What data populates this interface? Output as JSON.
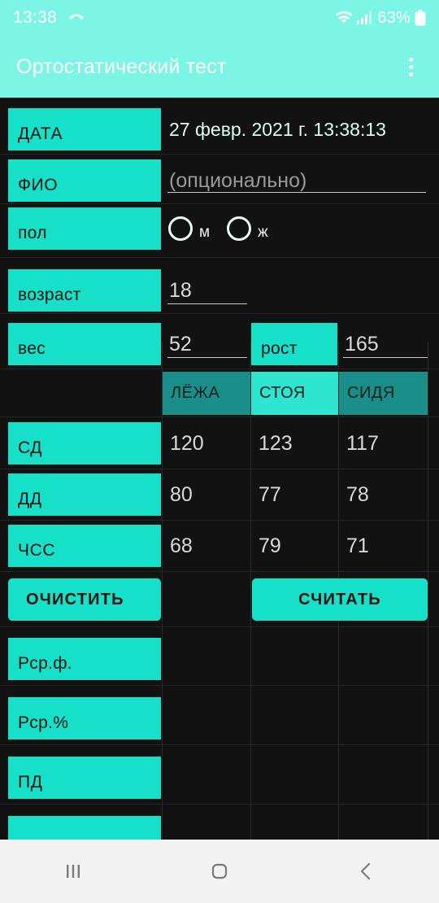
{
  "status_bar": {
    "time": "13:38",
    "call_icon": "missed-call-icon",
    "wifi_icon": "wifi-icon",
    "signal_icon": "signal-bars-icon",
    "battery_text": "63%",
    "battery_icon": "battery-icon"
  },
  "app_bar": {
    "title": "Ортостатический тест",
    "overflow_icon": "overflow-menu-icon"
  },
  "form": {
    "date": {
      "label": "ДАТА",
      "value": "27 февр. 2021 г. 13:38:13"
    },
    "name": {
      "label": "ФИО",
      "value": "",
      "placeholder": "(опционально)"
    },
    "sex": {
      "label": "пол",
      "options": [
        {
          "label": "м",
          "selected": false
        },
        {
          "label": "ж",
          "selected": false
        }
      ]
    },
    "age": {
      "label": "возраст",
      "value": "18"
    },
    "weight": {
      "label": "вес",
      "value": "52"
    },
    "height": {
      "label": "рост",
      "value": "165"
    }
  },
  "table": {
    "columns": [
      {
        "label": "ЛЁЖА",
        "active": false
      },
      {
        "label": "СТОЯ",
        "active": true
      },
      {
        "label": "СИДЯ",
        "active": false
      }
    ],
    "rows": [
      {
        "label": "СД",
        "values": [
          "120",
          "123",
          "117"
        ]
      },
      {
        "label": "ДД",
        "values": [
          "80",
          "77",
          "78"
        ]
      },
      {
        "label": "ЧСС",
        "values": [
          "68",
          "79",
          "71"
        ]
      }
    ],
    "result_rows": [
      {
        "label": "Рср.ф.",
        "values": [
          "",
          "",
          ""
        ]
      },
      {
        "label": "Рср.%",
        "values": [
          "",
          "",
          ""
        ]
      },
      {
        "label": "ПД",
        "values": [
          "",
          "",
          ""
        ]
      }
    ]
  },
  "buttons": {
    "clear": "ОЧИСТИТЬ",
    "calculate": "СЧИТАТЬ"
  },
  "nav_bar": {
    "recents_icon": "recents-icon",
    "home_icon": "home-icon",
    "back_icon": "back-icon"
  },
  "colors": {
    "accent": "#16e0c8",
    "accent_light": "#7df5e4",
    "accent_dark": "#1a8f8a",
    "background": "#121212",
    "nav_background": "#f2f2f2"
  }
}
